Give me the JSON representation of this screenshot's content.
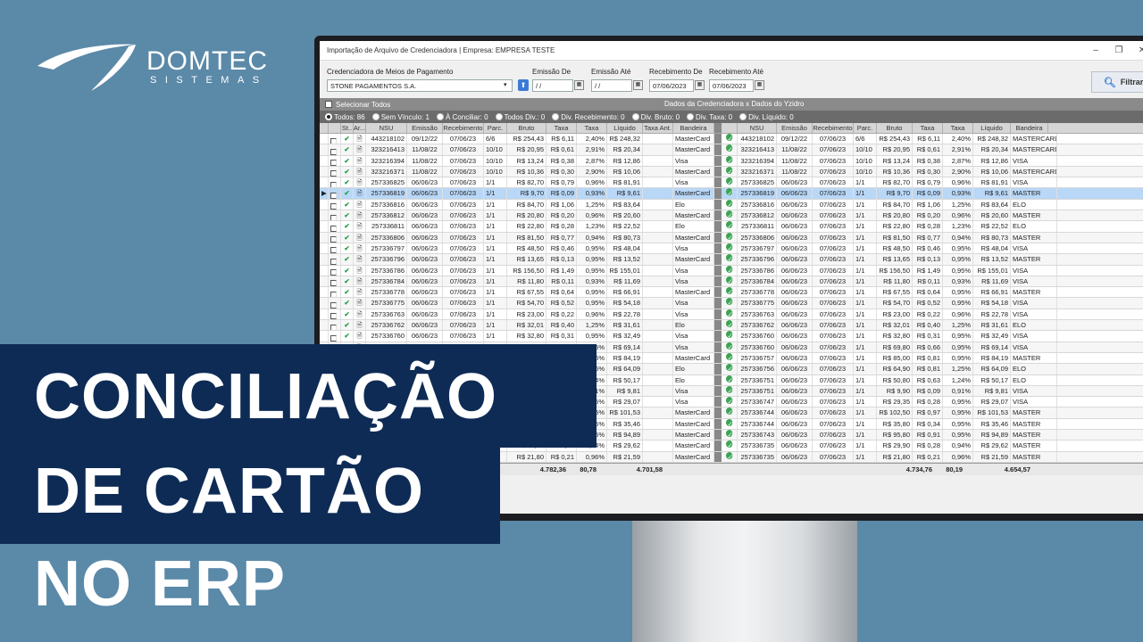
{
  "brand": {
    "name": "DOMTEC",
    "sub": "SISTEMAS"
  },
  "window": {
    "title": "Importação de Arquivo de Credenciadora | Empresa: EMPRESA TESTE",
    "controls": [
      "–",
      "❐",
      "✕"
    ]
  },
  "filters": {
    "credenciadora_label": "Credenciadora de Meios de Pagamento",
    "credenciadora_value": "STONE PAGAMENTOS S.A.",
    "emissao_de_label": "Emissão De",
    "emissao_de_value": " / /",
    "emissao_ate_label": "Emissão Até",
    "emissao_ate_value": " / /",
    "recebimento_de_label": "Recebimento De",
    "recebimento_de_value": "07/06/2023",
    "recebimento_ate_label": "Recebimento Até",
    "recebimento_ate_value": "07/06/2023",
    "filter_button": "Filtrar"
  },
  "select_bar": {
    "select_all": "Selecionar Todos",
    "center_title": "Dados da Credenciadora x Dados do Yzidro",
    "right": "0 /"
  },
  "radios": [
    "Todos: 86",
    "Sem Vínculo: 1",
    "À Conciliar: 0",
    "Todos Div.: 0",
    "Div. Recebimento: 0",
    "Div. Bruto: 0",
    "Div. Taxa: 0",
    "Div. Líquido: 0"
  ],
  "left_headers": [
    "St..",
    "Ar...",
    "NSU",
    "Emissão",
    "Recebimento",
    "Parc.",
    "Bruto",
    "Taxa",
    "Taxa",
    "Líquido",
    "Taxa Ant.",
    "Bandeira"
  ],
  "right_headers": [
    "NSU",
    "Emissão",
    "Recebimento",
    "Parc.",
    "Bruto",
    "Taxa",
    "Taxa",
    "Líquido",
    "Bandeira"
  ],
  "rows": [
    {
      "nsu": "443218102",
      "em": "09/12/22",
      "rec": "07/06/23",
      "parc": "6/6",
      "bruto": "R$ 254,43",
      "taxa": "R$ 6,11",
      "pct": "2,40%",
      "liq": "R$ 248,32",
      "band": "MasterCard",
      "band2": "MASTERCARD"
    },
    {
      "nsu": "323216413",
      "em": "11/08/22",
      "rec": "07/06/23",
      "parc": "10/10",
      "bruto": "R$ 20,95",
      "taxa": "R$ 0,61",
      "pct": "2,91%",
      "liq": "R$ 20,34",
      "band": "MasterCard",
      "band2": "MASTERCARD"
    },
    {
      "nsu": "323216394",
      "em": "11/08/22",
      "rec": "07/06/23",
      "parc": "10/10",
      "bruto": "R$ 13,24",
      "taxa": "R$ 0,38",
      "pct": "2,87%",
      "liq": "R$ 12,86",
      "band": "Visa",
      "band2": "VISA"
    },
    {
      "nsu": "323216371",
      "em": "11/08/22",
      "rec": "07/06/23",
      "parc": "10/10",
      "bruto": "R$ 10,36",
      "taxa": "R$ 0,30",
      "pct": "2,90%",
      "liq": "R$ 10,06",
      "band": "MasterCard",
      "band2": "MASTERCARD"
    },
    {
      "nsu": "257336825",
      "em": "06/06/23",
      "rec": "07/06/23",
      "parc": "1/1",
      "bruto": "R$ 82,70",
      "taxa": "R$ 0,79",
      "pct": "0,96%",
      "liq": "R$ 81,91",
      "band": "Visa",
      "band2": "VISA"
    },
    {
      "nsu": "257336819",
      "em": "06/06/23",
      "rec": "07/06/23",
      "parc": "1/1",
      "bruto": "R$ 9,70",
      "taxa": "R$ 0,09",
      "pct": "0,93%",
      "liq": "R$ 9,61",
      "band": "MasterCard",
      "band2": "MASTER"
    },
    {
      "nsu": "257336816",
      "em": "06/06/23",
      "rec": "07/06/23",
      "parc": "1/1",
      "bruto": "R$ 84,70",
      "taxa": "R$ 1,06",
      "pct": "1,25%",
      "liq": "R$ 83,64",
      "band": "Elo",
      "band2": "ELO"
    },
    {
      "nsu": "257336812",
      "em": "06/06/23",
      "rec": "07/06/23",
      "parc": "1/1",
      "bruto": "R$ 20,80",
      "taxa": "R$ 0,20",
      "pct": "0,96%",
      "liq": "R$ 20,60",
      "band": "MasterCard",
      "band2": "MASTER"
    },
    {
      "nsu": "257336811",
      "em": "06/06/23",
      "rec": "07/06/23",
      "parc": "1/1",
      "bruto": "R$ 22,80",
      "taxa": "R$ 0,28",
      "pct": "1,23%",
      "liq": "R$ 22,52",
      "band": "Elo",
      "band2": "ELO"
    },
    {
      "nsu": "257336806",
      "em": "06/06/23",
      "rec": "07/06/23",
      "parc": "1/1",
      "bruto": "R$ 81,50",
      "taxa": "R$ 0,77",
      "pct": "0,94%",
      "liq": "R$ 80,73",
      "band": "MasterCard",
      "band2": "MASTER"
    },
    {
      "nsu": "257336797",
      "em": "06/06/23",
      "rec": "07/06/23",
      "parc": "1/1",
      "bruto": "R$ 48,50",
      "taxa": "R$ 0,46",
      "pct": "0,95%",
      "liq": "R$ 48,04",
      "band": "Visa",
      "band2": "VISA"
    },
    {
      "nsu": "257336796",
      "em": "06/06/23",
      "rec": "07/06/23",
      "parc": "1/1",
      "bruto": "R$ 13,65",
      "taxa": "R$ 0,13",
      "pct": "0,95%",
      "liq": "R$ 13,52",
      "band": "MasterCard",
      "band2": "MASTER"
    },
    {
      "nsu": "257336786",
      "em": "06/06/23",
      "rec": "07/06/23",
      "parc": "1/1",
      "bruto": "R$ 156,50",
      "taxa": "R$ 1,49",
      "pct": "0,95%",
      "liq": "R$ 155,01",
      "band": "Visa",
      "band2": "VISA"
    },
    {
      "nsu": "257336784",
      "em": "06/06/23",
      "rec": "07/06/23",
      "parc": "1/1",
      "bruto": "R$ 11,80",
      "taxa": "R$ 0,11",
      "pct": "0,93%",
      "liq": "R$ 11,69",
      "band": "Visa",
      "band2": "VISA"
    },
    {
      "nsu": "257336778",
      "em": "06/06/23",
      "rec": "07/06/23",
      "parc": "1/1",
      "bruto": "R$ 67,55",
      "taxa": "R$ 0,64",
      "pct": "0,95%",
      "liq": "R$ 66,91",
      "band": "MasterCard",
      "band2": "MASTER"
    },
    {
      "nsu": "257336775",
      "em": "06/06/23",
      "rec": "07/06/23",
      "parc": "1/1",
      "bruto": "R$ 54,70",
      "taxa": "R$ 0,52",
      "pct": "0,95%",
      "liq": "R$ 54,18",
      "band": "Visa",
      "band2": "VISA"
    },
    {
      "nsu": "257336763",
      "em": "06/06/23",
      "rec": "07/06/23",
      "parc": "1/1",
      "bruto": "R$ 23,00",
      "taxa": "R$ 0,22",
      "pct": "0,96%",
      "liq": "R$ 22,78",
      "band": "Visa",
      "band2": "VISA"
    },
    {
      "nsu": "257336762",
      "em": "06/06/23",
      "rec": "07/06/23",
      "parc": "1/1",
      "bruto": "R$ 32,01",
      "taxa": "R$ 0,40",
      "pct": "1,25%",
      "liq": "R$ 31,61",
      "band": "Elo",
      "band2": "ELO"
    },
    {
      "nsu": "257336760",
      "em": "06/06/23",
      "rec": "07/06/23",
      "parc": "1/1",
      "bruto": "R$ 32,80",
      "taxa": "R$ 0,31",
      "pct": "0,95%",
      "liq": "R$ 32,49",
      "band": "Visa",
      "band2": "VISA"
    },
    {
      "nsu": "257336760",
      "em": "06/06/23",
      "rec": "07/06/23",
      "parc": "1/1",
      "bruto": "R$ 69,80",
      "taxa": "R$ 0,66",
      "pct": "0,95%",
      "liq": "R$ 69,14",
      "band": "Visa",
      "band2": "VISA"
    },
    {
      "nsu": "257336757",
      "em": "06/06/23",
      "rec": "07/06/23",
      "parc": "1/1",
      "bruto": "R$ 85,00",
      "taxa": "R$ 0,81",
      "pct": "0,95%",
      "liq": "R$ 84,19",
      "band": "MasterCard",
      "band2": "MASTER"
    },
    {
      "nsu": "257336756",
      "em": "06/06/23",
      "rec": "07/06/23",
      "parc": "1/1",
      "bruto": "R$ 64,90",
      "taxa": "R$ 0,81",
      "pct": "1,25%",
      "liq": "R$ 64,09",
      "band": "Elo",
      "band2": "ELO"
    },
    {
      "nsu": "257336751",
      "em": "06/06/23",
      "rec": "07/06/23",
      "parc": "1/1",
      "bruto": "R$ 50,80",
      "taxa": "R$ 0,63",
      "pct": "1,24%",
      "liq": "R$ 50,17",
      "band": "Elo",
      "band2": "ELO"
    },
    {
      "nsu": "257336751",
      "em": "06/06/23",
      "rec": "07/06/23",
      "parc": "1/1",
      "bruto": "R$ 9,90",
      "taxa": "R$ 0,09",
      "pct": "0,91%",
      "liq": "R$ 9,81",
      "band": "Visa",
      "band2": "VISA"
    },
    {
      "nsu": "257336747",
      "em": "06/06/23",
      "rec": "07/06/23",
      "parc": "1/1",
      "bruto": "R$ 29,35",
      "taxa": "R$ 0,28",
      "pct": "0,95%",
      "liq": "R$ 29,07",
      "band": "Visa",
      "band2": "VISA"
    },
    {
      "nsu": "257336744",
      "em": "06/06/23",
      "rec": "07/06/23",
      "parc": "1/1",
      "bruto": "R$ 102,50",
      "taxa": "R$ 0,97",
      "pct": "0,95%",
      "liq": "R$ 101,53",
      "band": "MasterCard",
      "band2": "MASTER"
    },
    {
      "nsu": "257336744",
      "em": "06/06/23",
      "rec": "07/06/23",
      "parc": "1/1",
      "bruto": "R$ 35,80",
      "taxa": "R$ 0,34",
      "pct": "0,95%",
      "liq": "R$ 35,46",
      "band": "MasterCard",
      "band2": "MASTER"
    },
    {
      "nsu": "257336743",
      "em": "06/06/23",
      "rec": "07/06/23",
      "parc": "1/1",
      "bruto": "R$ 95,80",
      "taxa": "R$ 0,91",
      "pct": "0,95%",
      "liq": "R$ 94,89",
      "band": "MasterCard",
      "band2": "MASTER"
    },
    {
      "nsu": "257336735",
      "em": "06/06/23",
      "rec": "07/06/23",
      "parc": "1/1",
      "bruto": "R$ 29,90",
      "taxa": "R$ 0,28",
      "pct": "0,94%",
      "liq": "R$ 29,62",
      "band": "MasterCard",
      "band2": "MASTER"
    },
    {
      "nsu": "257336735",
      "em": "06/06/23",
      "rec": "07/06/23",
      "parc": "1/1",
      "bruto": "R$ 21,80",
      "taxa": "R$ 0,21",
      "pct": "0,96%",
      "liq": "R$ 21,59",
      "band": "MasterCard",
      "band2": "MASTER"
    }
  ],
  "totals": {
    "left_bruto": "4.782,36",
    "left_taxa": "80,78",
    "left_liq": "4.701,58",
    "right_bruto": "4.734,76",
    "right_taxa": "80,19",
    "right_liq": "4.654,57"
  },
  "headline": {
    "line1": "CONCILIAÇÃO",
    "line2": "DE CARTÃO",
    "line3": "NO ERP"
  },
  "colors": {
    "background": "#5b89a8",
    "banner": "#0e2b55",
    "selected_row": "#b9d7f7",
    "ok_green": "#20a040"
  }
}
